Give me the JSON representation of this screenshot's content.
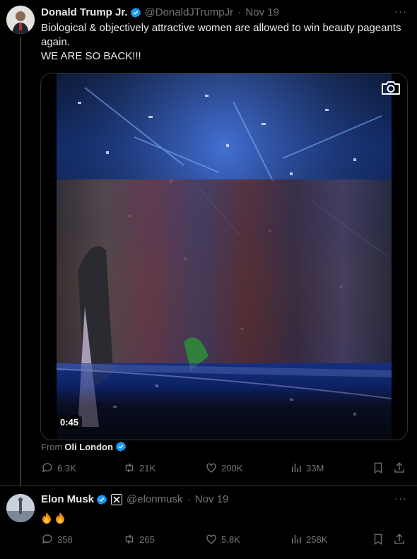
{
  "tweets": [
    {
      "author": "Donald Trump Jr.",
      "handle": "@DonaldJTrumpJr",
      "date": "Nov 19",
      "text_line1": "Biological & objectively attractive women are allowed to win beauty pageants again.",
      "text_line2": "WE ARE SO BACK!!!",
      "video_time": "0:45",
      "from_label": "From",
      "from_name": "Oli London",
      "stats": {
        "replies": "6.3K",
        "retweets": "21K",
        "likes": "200K",
        "views": "33M"
      }
    },
    {
      "author": "Elon Musk",
      "handle": "@elonmusk",
      "date": "Nov 19",
      "text": "🔥🔥",
      "stats": {
        "replies": "358",
        "retweets": "265",
        "likes": "5.8K",
        "views": "258K"
      }
    }
  ],
  "more_label": "···",
  "colors": {
    "verified": "#1d9bf0",
    "muted": "#71767b",
    "text": "#e7e9ea",
    "border": "#2f3336"
  }
}
